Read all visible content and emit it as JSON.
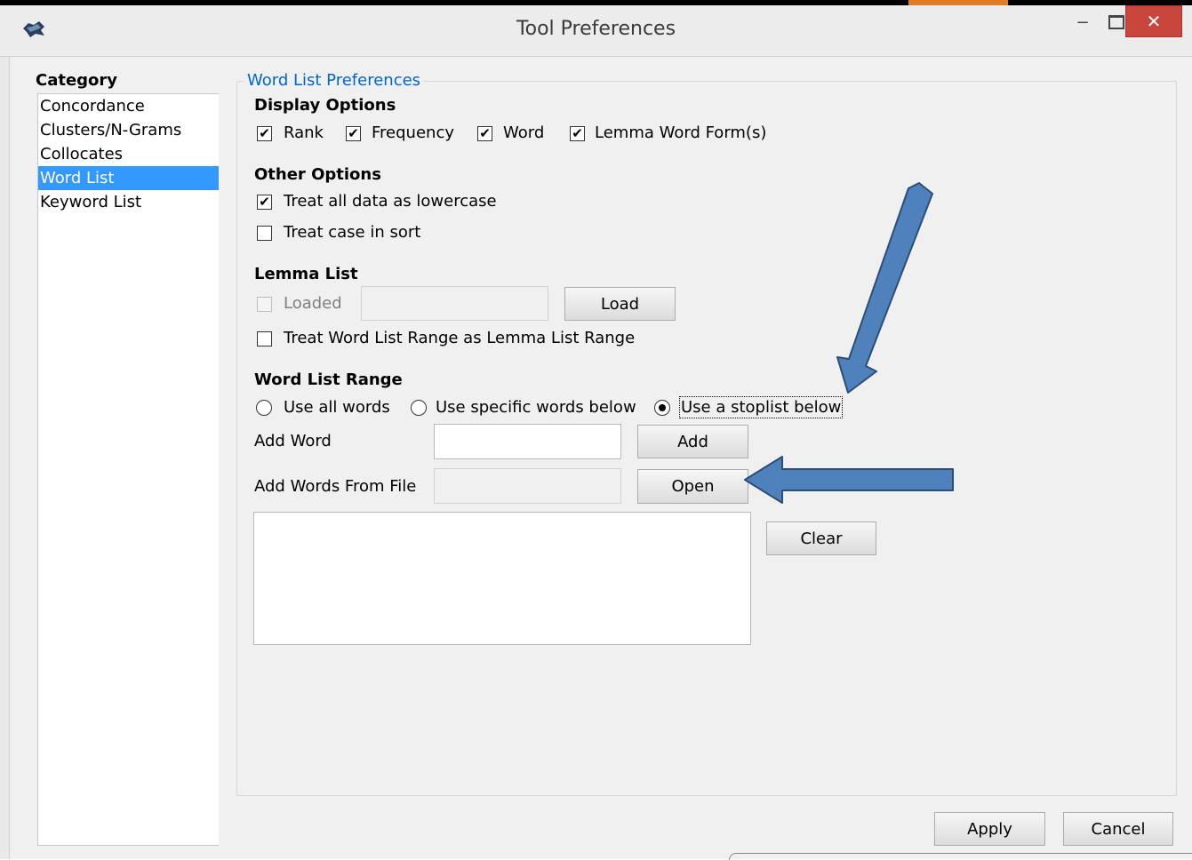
{
  "window": {
    "title": "Tool Preferences",
    "minimize": "−",
    "close": "✕"
  },
  "category": {
    "label": "Category",
    "items": [
      "Concordance",
      "Clusters/N-Grams",
      "Collocates",
      "Word List",
      "Keyword List"
    ],
    "selected": "Word List"
  },
  "group": {
    "title": "Word List Preferences"
  },
  "display_options": {
    "heading": "Display Options",
    "rank": {
      "label": "Rank",
      "checked": true
    },
    "frequency": {
      "label": "Frequency",
      "checked": true
    },
    "word": {
      "label": "Word",
      "checked": true
    },
    "lemma_forms": {
      "label": "Lemma Word Form(s)",
      "checked": true
    }
  },
  "other_options": {
    "heading": "Other Options",
    "lowercase": {
      "label": "Treat all data as lowercase",
      "checked": true
    },
    "case_sort": {
      "label": "Treat case in sort",
      "checked": false
    }
  },
  "lemma_list": {
    "heading": "Lemma List",
    "loaded": {
      "label": "Loaded",
      "checked": false,
      "disabled": true
    },
    "file_value": "",
    "load_label": "Load",
    "range_as_lemma": {
      "label": "Treat Word List Range as Lemma List Range",
      "checked": false
    }
  },
  "word_list_range": {
    "heading": "Word List Range",
    "options": [
      "Use all words",
      "Use specific words below",
      "Use a stoplist below"
    ],
    "selected": "Use a stoplist below",
    "add_word_label": "Add Word",
    "add_word_value": "",
    "add_label": "Add",
    "add_file_label": "Add Words From File",
    "add_file_value": "",
    "open_label": "Open",
    "words": "",
    "clear_label": "Clear"
  },
  "footer": {
    "apply_label": "Apply",
    "cancel_label": "Cancel"
  },
  "colors": {
    "selection": "#3399ff",
    "group_title": "#0066cc",
    "arrow_fill": "#4f81bd",
    "arrow_stroke": "#2c4d75",
    "close_button": "#c9463d"
  }
}
